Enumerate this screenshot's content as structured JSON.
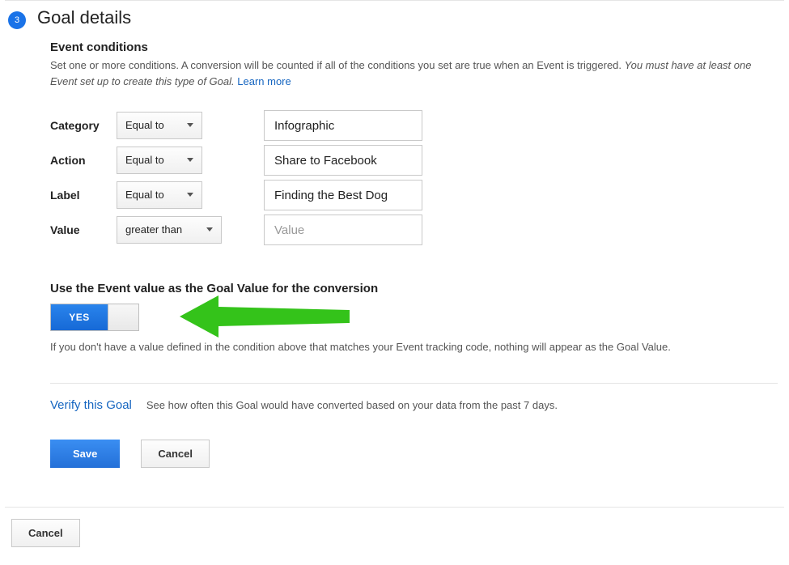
{
  "step": {
    "number": "3",
    "title": "Goal details"
  },
  "eventConditions": {
    "title": "Event conditions",
    "help_plain": "Set one or more conditions. A conversion will be counted if all of the conditions you set are true when an Event is triggered. ",
    "help_italic": "You must have at least one Event set up to create this type of Goal.",
    "learn_more": "Learn more",
    "rows": {
      "category": {
        "label": "Category",
        "operator": "Equal to",
        "value": "Infographic"
      },
      "action": {
        "label": "Action",
        "operator": "Equal to",
        "value": "Share to Facebook"
      },
      "label": {
        "label": "Label",
        "operator": "Equal to",
        "value": "Finding the Best Dog"
      },
      "value": {
        "label": "Value",
        "operator": "greater than",
        "placeholder": "Value",
        "value": ""
      }
    }
  },
  "goalValue": {
    "question": "Use the Event value as the Goal Value for the conversion",
    "toggle_on_label": "YES",
    "note": "If you don't have a value defined in the condition above that matches your Event tracking code, nothing will appear as the Goal Value."
  },
  "verify": {
    "link": "Verify this Goal",
    "desc": "See how often this Goal would have converted based on your data from the past 7 days."
  },
  "buttons": {
    "save": "Save",
    "cancel": "Cancel"
  },
  "outer": {
    "cancel": "Cancel"
  }
}
